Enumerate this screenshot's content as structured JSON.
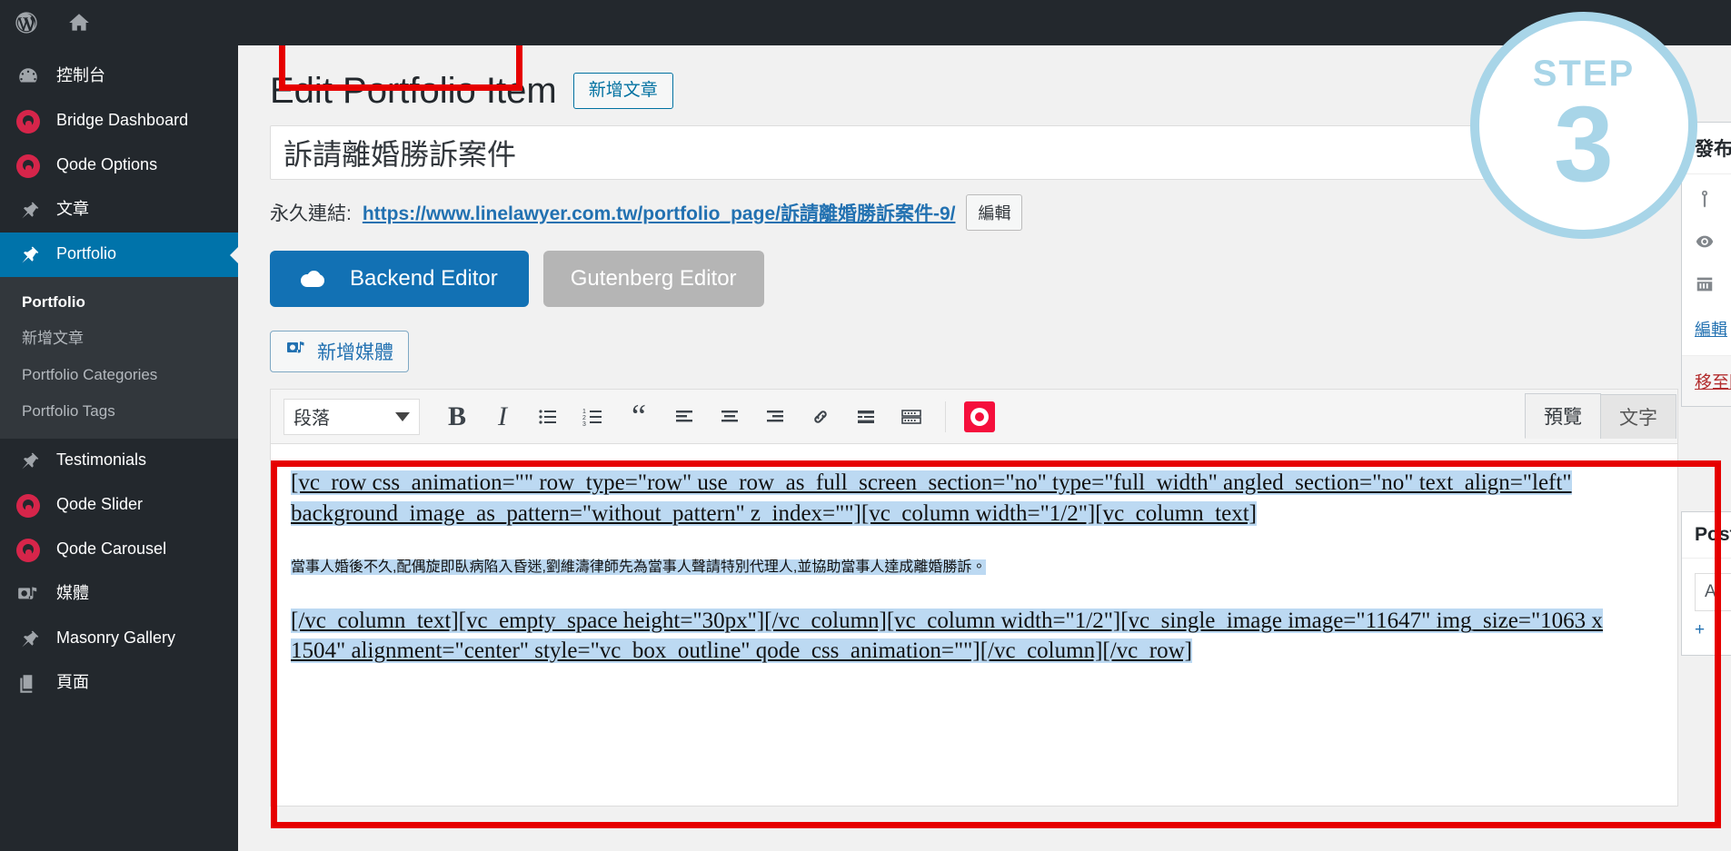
{
  "colors": {
    "admin_bar": "#23282d",
    "menu_current": "#0073aa",
    "accent_blue": "#1271b4",
    "qode_red": "#d6254a",
    "highlight_red": "#e60000",
    "step_blue": "#a8d5e8",
    "selection_blue": "#bcd9f2"
  },
  "adminbar": {
    "logo_icon": "wordpress-logo-icon",
    "home_icon": "home-icon"
  },
  "sidebar": {
    "items": [
      {
        "label": "控制台",
        "icon": "dashboard-icon",
        "current": false
      },
      {
        "label": "Bridge Dashboard",
        "icon": "qode-circle-icon",
        "current": false
      },
      {
        "label": "Qode Options",
        "icon": "qode-circle-icon",
        "current": false
      },
      {
        "label": "文章",
        "icon": "pin-icon",
        "current": false
      },
      {
        "label": "Portfolio",
        "icon": "pin-icon",
        "current": true
      },
      {
        "label": "Testimonials",
        "icon": "pin-icon",
        "current": false
      },
      {
        "label": "Qode Slider",
        "icon": "qode-circle-icon",
        "current": false
      },
      {
        "label": "Qode Carousel",
        "icon": "qode-circle-icon",
        "current": false
      },
      {
        "label": "媒體",
        "icon": "media-icon",
        "current": false
      },
      {
        "label": "Masonry Gallery",
        "icon": "pin-icon",
        "current": false
      },
      {
        "label": "頁面",
        "icon": "pages-icon",
        "current": false
      }
    ],
    "submenu": [
      {
        "label": "Portfolio",
        "current": true
      },
      {
        "label": "新增文章",
        "current": false
      },
      {
        "label": "Portfolio Categories",
        "current": false
      },
      {
        "label": "Portfolio Tags",
        "current": false
      }
    ]
  },
  "header": {
    "page_title": "Edit Portfolio Item",
    "add_new_label": "新增文章"
  },
  "title_field": {
    "value": "訴請離婚勝訴案件"
  },
  "permalink": {
    "label": "永久連結:",
    "url": "https://www.linelawyer.com.tw/portfolio_page/訴請離婚勝訴案件-9/",
    "edit_label": "編輯"
  },
  "editor_switch": {
    "backend_label": "Backend Editor",
    "gutenberg_label": "Gutenberg Editor"
  },
  "media": {
    "add_media_label": "新增媒體",
    "add_media_icon": "add-media-icon"
  },
  "editor_tabs": [
    {
      "label": "預覽",
      "active": true
    },
    {
      "label": "文字",
      "active": false
    }
  ],
  "toolbar": {
    "format_value": "段落",
    "buttons": [
      {
        "name": "bold-icon",
        "glyph": "B"
      },
      {
        "name": "italic-icon",
        "glyph": "I"
      },
      {
        "name": "bulleted-list-icon",
        "glyph": ""
      },
      {
        "name": "numbered-list-icon",
        "glyph": ""
      },
      {
        "name": "blockquote-icon",
        "glyph": "“"
      },
      {
        "name": "align-left-icon",
        "glyph": ""
      },
      {
        "name": "align-center-icon",
        "glyph": ""
      },
      {
        "name": "align-right-icon",
        "glyph": ""
      },
      {
        "name": "insert-link-icon",
        "glyph": ""
      },
      {
        "name": "read-more-icon",
        "glyph": ""
      },
      {
        "name": "toolbar-toggle-icon",
        "glyph": ""
      },
      {
        "name": "qode-shortcodes-icon",
        "glyph": ""
      }
    ],
    "fullscreen_icon": "fullscreen-icon"
  },
  "editor_content": {
    "shortcode_block_1": "[vc_row css_animation=\"\" row_type=\"row\" use_row_as_full_screen_section=\"no\" type=\"full_width\" angled_section=\"no\" text_align=\"left\" background_image_as_pattern=\"without_pattern\" z_index=\"\"][vc_column width=\"1/2\"][vc_column_text]",
    "chinese_paragraph": "當事人婚後不久,配偶旋即臥病陷入昏迷,劉維濤律師先為當事人聲請特別代理人,並協助當事人達成離婚勝訴。",
    "shortcode_block_2": "[/vc_column_text][vc_empty_space height=\"30px\"][/vc_column][vc_column width=\"1/2\"][vc_single_image image=\"11647\" img_size=\"1063 x 1504\" alignment=\"center\" style=\"vc_box_outline\" qode_css_animation=\"\"][/vc_column][/vc_row]"
  },
  "publish_box": {
    "title": "發布",
    "status_icon": "pin-key-icon",
    "visibility_icon": "eye-icon",
    "schedule_icon": "calendar-icon",
    "edit_label": "編輯",
    "trash_label": "移至回收桶"
  },
  "post_box": {
    "title": "Post",
    "field_value": "A",
    "add_label": "+"
  },
  "step_badge": {
    "word": "STEP",
    "number": "3"
  }
}
